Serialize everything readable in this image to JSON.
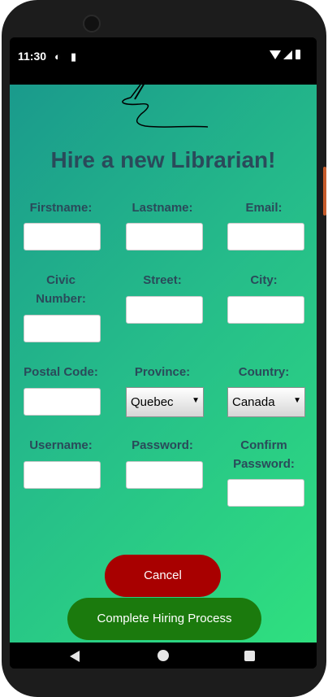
{
  "status": {
    "time": "11:30",
    "notif_icon_1": "circle-app-icon",
    "notif_icon_2": "sd-card-icon",
    "right_icons": [
      "wifi-icon",
      "signal-icon",
      "battery-icon"
    ]
  },
  "form": {
    "title": "Hire a new Librarian!",
    "labels": {
      "firstname": "Firstname:",
      "lastname": "Lastname:",
      "email": "Email:",
      "civic_number": "Civic Number:",
      "street": "Street:",
      "city": "City:",
      "postal_code": "Postal Code:",
      "province": "Province:",
      "country": "Country:",
      "username": "Username:",
      "password": "Password:",
      "confirm_password": "Confirm Password:"
    },
    "values": {
      "firstname": "",
      "lastname": "",
      "email": "",
      "civic_number": "",
      "street": "",
      "city": "",
      "postal_code": "",
      "username": "",
      "password": "",
      "confirm_password": ""
    },
    "province_selected": "Quebec",
    "country_selected": "Canada"
  },
  "buttons": {
    "cancel": "Cancel",
    "complete": "Complete Hiring Process"
  },
  "colors": {
    "accent_text": "#2a4a5a",
    "cancel_bg": "#a80000",
    "complete_bg": "#1b7a0d",
    "gradient_start": "#1a9a8c",
    "gradient_end": "#2fe07f"
  },
  "navbar": {
    "icons": [
      "back-icon",
      "home-icon",
      "recents-icon"
    ]
  }
}
